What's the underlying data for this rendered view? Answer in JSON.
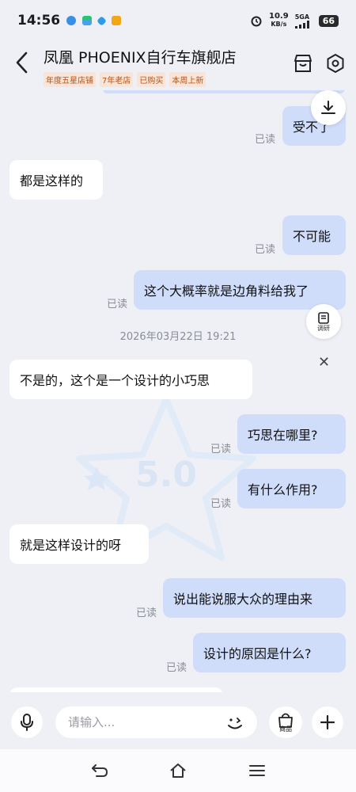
{
  "status_bar": {
    "time": "14:56",
    "net_speed": "10.9",
    "net_unit": "KB/s",
    "signal": "5GA",
    "battery": "66"
  },
  "header": {
    "shop_name": "凤凰 PHOENIX自行车旗舰店",
    "tags": [
      "年度五星店铺",
      "7年老店",
      "已购买",
      "本周上新"
    ]
  },
  "chat": {
    "messages": [
      {
        "side": "out",
        "text": "受不了",
        "status": "已读"
      },
      {
        "side": "in",
        "text": "都是这样的"
      },
      {
        "side": "out",
        "text": "不可能",
        "status": "已读"
      },
      {
        "side": "out",
        "text": "这个大概率就是边角料给我了",
        "status": "已读"
      },
      {
        "side": "in",
        "text": "不是的，这个是一个设计的小巧思"
      },
      {
        "side": "out",
        "text": "巧思在哪里?",
        "status": "已读"
      },
      {
        "side": "out",
        "text": "有什么作用?",
        "status": "已读"
      },
      {
        "side": "in",
        "text": "就是这样设计的呀"
      },
      {
        "side": "out",
        "text": "说出能说服大众的理由来",
        "status": "已读"
      },
      {
        "side": "out",
        "text": "设计的原因是什么?",
        "status": "已读"
      }
    ],
    "timestamp": "2026年03月22日 19:21",
    "research_label": "调研",
    "close_symbol": "✕",
    "watermark_score": "5.0"
  },
  "input_bar": {
    "placeholder": "请输入...",
    "goods_label": "商品"
  },
  "colors": {
    "bubble_out": "#cfdcfa",
    "bubble_in": "#ffffff",
    "tag_text": "#b0541b",
    "tag_bg": "#fbe4d5",
    "background": "#eef0f6"
  },
  "icons": [
    "back-icon",
    "store-icon",
    "settings-icon",
    "download-icon",
    "research-icon",
    "close-icon",
    "microphone-icon",
    "emoji-icon",
    "goods-bag-icon",
    "plus-icon",
    "nav-back-icon",
    "nav-home-icon",
    "nav-menu-icon"
  ]
}
